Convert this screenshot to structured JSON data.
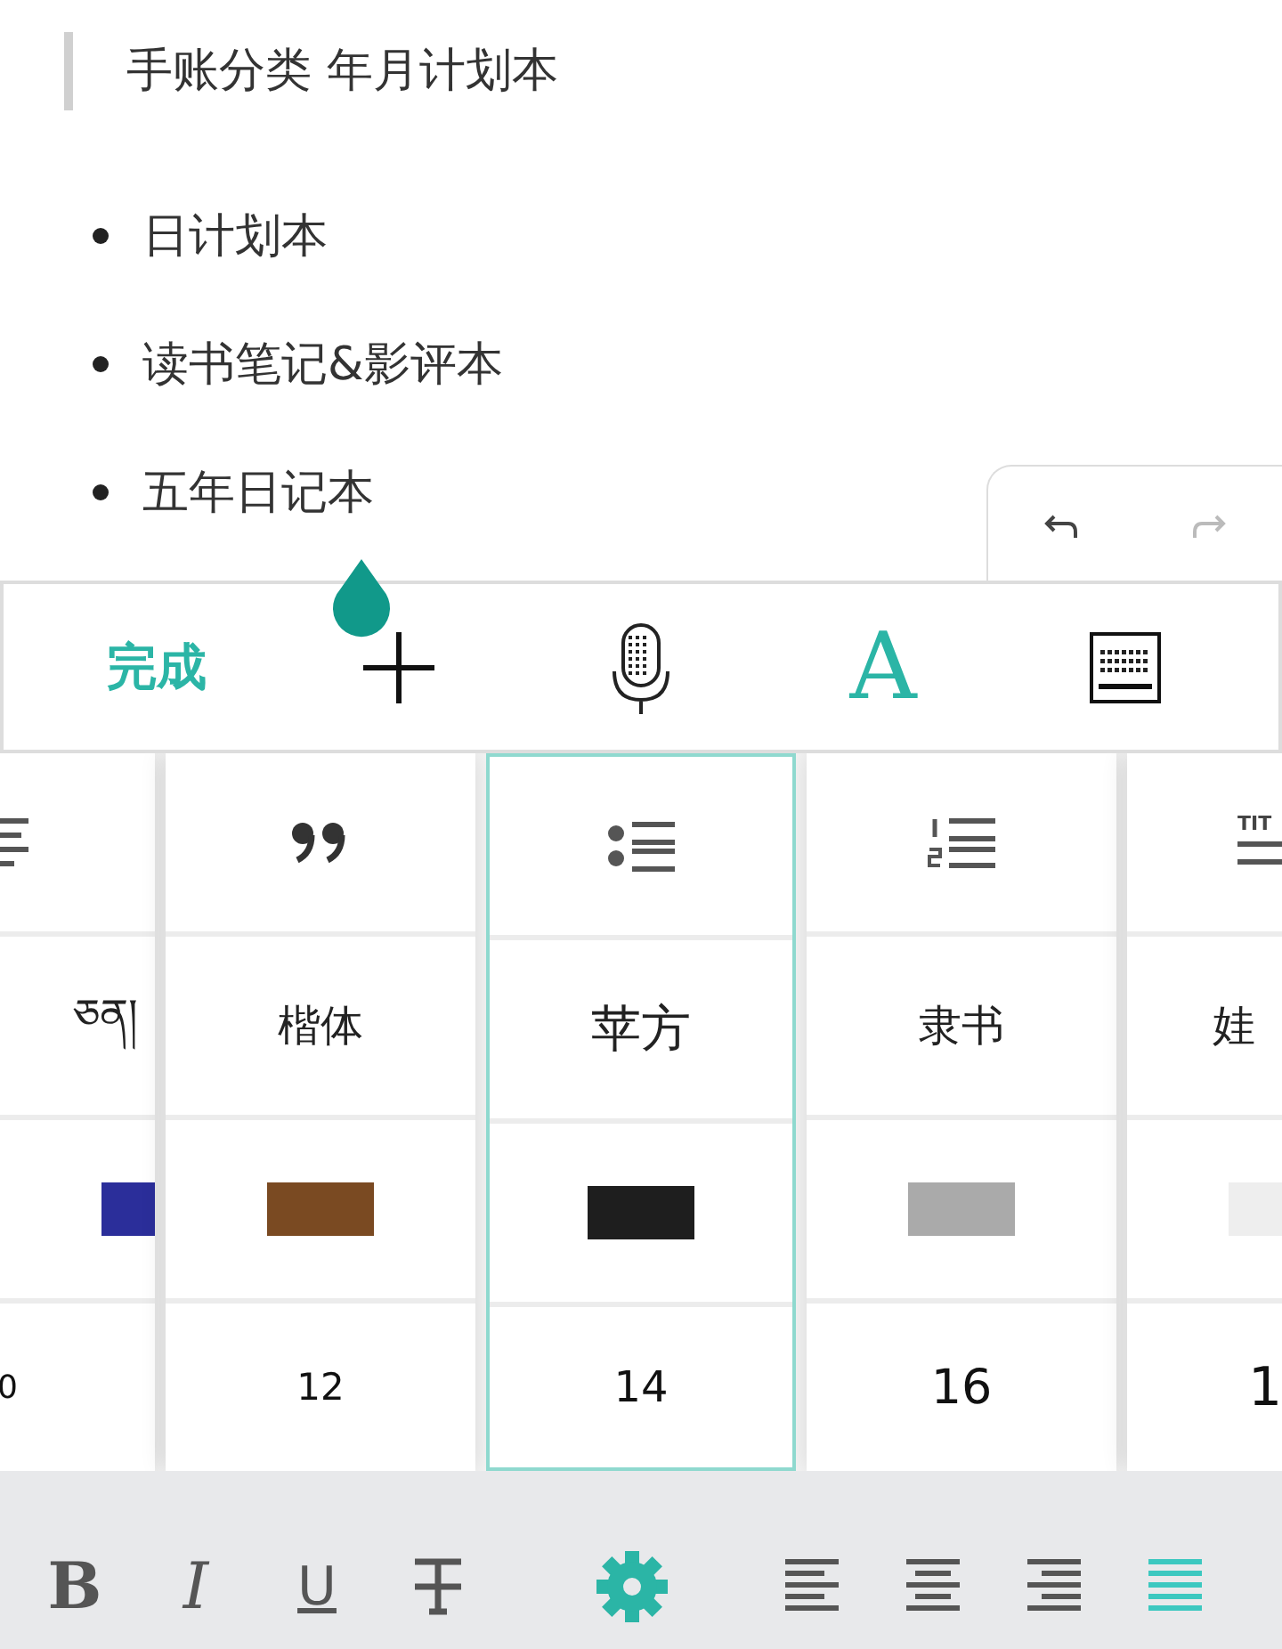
{
  "note": {
    "quote": "手账分类 年月计划本",
    "bullets": [
      "日计划本",
      "读书笔记&影评本",
      "五年日记本"
    ]
  },
  "history": {
    "undo": {
      "disabled": false
    },
    "redo": {
      "disabled": true
    }
  },
  "toolbar": {
    "done": "完成",
    "items": [
      {
        "kind": "plus"
      },
      {
        "kind": "mic"
      },
      {
        "kind": "font",
        "label": "A"
      },
      {
        "kind": "keyboard"
      }
    ]
  },
  "picker": {
    "columns": [
      {
        "selected": false,
        "kind": "lines",
        "font_label": "ཅན།",
        "color": "#2b2e9a",
        "size": "0"
      },
      {
        "selected": false,
        "kind": "quote",
        "font_label": "楷体",
        "color": "#7a4a22",
        "size": "12"
      },
      {
        "selected": true,
        "kind": "bullets",
        "font_label": "苹方",
        "color": "#1e1e1e",
        "size": "14"
      },
      {
        "selected": false,
        "kind": "numbers",
        "font_label": "隶书",
        "color": "#aaaaaa",
        "size": "16"
      },
      {
        "selected": false,
        "kind": "title",
        "icon_label": "TIT",
        "font_label": "娃",
        "color": "#eeeeee",
        "size": "1"
      }
    ]
  },
  "format_bar": {
    "styles": [
      {
        "kind": "bold",
        "label": "B"
      },
      {
        "kind": "italic",
        "label": "I"
      },
      {
        "kind": "underline",
        "label": "U"
      },
      {
        "kind": "strike"
      }
    ],
    "settings": {
      "kind": "gear"
    },
    "align": [
      {
        "kind": "left",
        "selected": false
      },
      {
        "kind": "center",
        "selected": false
      },
      {
        "kind": "right",
        "selected": false
      },
      {
        "kind": "justify",
        "selected": true
      }
    ]
  }
}
